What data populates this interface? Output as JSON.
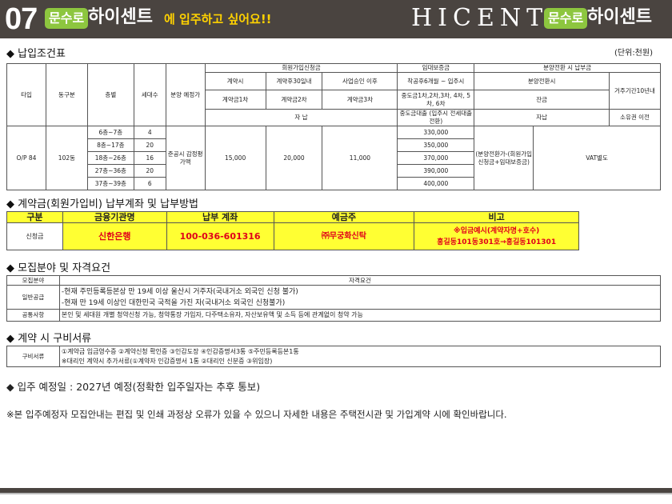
{
  "header": {
    "number": "07",
    "pill_left": "문수로",
    "brand_left": "하이센트",
    "subtitle": "에 입주하고 싶어요!!",
    "logo": "HICENT",
    "pill_right": "문수로",
    "brand_right": "하이센트"
  },
  "section1": {
    "title": "◆ 납입조건표",
    "unit": "(단위:천원)",
    "col_type": "타입",
    "col_dong": "동구분",
    "col_floor": "층별",
    "col_units": "세대수",
    "col_price": "분양 예정가",
    "grp_member": "회원가입신청금",
    "grp_lease": "임대보증금",
    "grp_sale": "분양전환 시 납부금",
    "h_contract": "계약시",
    "h_within30": "계약후30일내",
    "h_approval": "사업승인 이후",
    "h_lease_sub": "착공후6개월 ~ 입주시",
    "h_sale_time": "분양전환시",
    "h_residence": "거주기간10년내",
    "h_c1": "계약금1차",
    "h_c2": "계약금2차",
    "h_c3": "계약금3차",
    "h_mid": "중도금1차,2차,3차, 4차, 5차, 6차",
    "h_balance": "잔금",
    "h_self1": "자 납",
    "h_loan": "중도금대출 (입주시 전세대출전환)",
    "h_self2": "자납",
    "h_before_transfer": "소유권 이전",
    "type": "O/P 84",
    "dong": "102동",
    "rows": [
      {
        "floor": "6층~7층",
        "units": "4",
        "lease": "330,000"
      },
      {
        "floor": "8층~17층",
        "units": "20",
        "lease": "350,000"
      },
      {
        "floor": "18층~26층",
        "units": "16",
        "lease": "370,000"
      },
      {
        "floor": "27층~36층",
        "units": "20",
        "lease": "390,000"
      },
      {
        "floor": "37층~39층",
        "units": "6",
        "lease": "400,000"
      }
    ],
    "price": "준공시 감정평가액",
    "c1": "15,000",
    "c2": "20,000",
    "c3": "11,000",
    "balance": "(분양전환가-(회원가입신청금+임대보증금)",
    "vat": "VAT별도"
  },
  "section2": {
    "title": "◆ 계약금(회원가입비) 납부계좌 및 납부방법",
    "h_div": "구분",
    "h_bank": "금융기관명",
    "h_account": "납부 계좌",
    "h_holder": "예금주",
    "h_remark": "비고",
    "div": "신청금",
    "bank": "신한은행",
    "account": "100-036-601316",
    "holder": "㈜무궁화신탁",
    "remark1": "※입금예시(계약자명+호수)",
    "remark2": "홍길동101동301호→홍길동101301"
  },
  "section3": {
    "title": "◆ 모집분야 및 자격요건",
    "h_field": "모집분야",
    "h_req": "자격요건",
    "general": "일반공급",
    "general1": "-현재 주민등록등본상 만 19세 이상 울산시 거주자(국내거소 외국인 신청 불가)",
    "general2": "-현재 만 19세 이상인 대한민국 국적을 가진 자(국내거소 외국인 신청불가)",
    "common": "공통사항",
    "common_text": "본인 및 세대원 개별 청약신청 가능, 청약통장 가입자, 다주택소유자, 자산보유액 및 소득 등에 관계없이 청약 가능"
  },
  "section4": {
    "title": "◆ 계약 시 구비서류",
    "label": "구비서류",
    "line1": "①계약금 입금영수증 ②계약신청 확인증 ③인감도장 ④인감증명서3통 ⑤주민등록등본1통",
    "line2": "※대리인 계약시 추가서류(①계약자 인감증명서 1통 ②대리인 신분증 ③위임장)"
  },
  "move_in": "◆ 입주 예정일 : 2027년 예정(정확한 입주일자는 추후 통보)",
  "disclaimer": "※본 입주예정자 모집안내는 편집 및 인쇄 과정상 오류가 있을 수 있으니 자세한 내용은 주택전시관 및 가입계약 시에 확인바랍니다."
}
